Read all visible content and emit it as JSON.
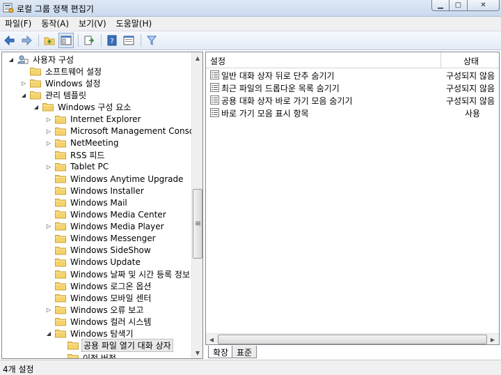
{
  "window": {
    "title": "로컬 그룹 정책 편집기",
    "icon": "gpedit-icon",
    "buttons": {
      "minimize": "▁",
      "maximize": "▢",
      "close": "✕"
    }
  },
  "menu": [
    "파일(F)",
    "동작(A)",
    "보기(V)",
    "도움말(H)"
  ],
  "toolbar": {
    "buttons": [
      "back-icon",
      "forward-icon",
      "up-folder-icon",
      "show-hide-tree-icon",
      "export-list-icon",
      "help-icon",
      "properties-icon",
      "filter-icon"
    ]
  },
  "tree": {
    "rows": [
      {
        "label": "사용자 구성",
        "expander": "expanded",
        "icon": "user-config-icon"
      },
      {
        "label": "소프트웨어 설정",
        "expander": "none",
        "icon": "folder-icon"
      },
      {
        "label": "Windows 설정",
        "expander": "collapsed",
        "icon": "folder-icon"
      },
      {
        "label": "관리 템플릿",
        "expander": "expanded",
        "icon": "folder-icon"
      },
      {
        "label": "Windows 구성 요소",
        "expander": "expanded",
        "icon": "folder-icon"
      },
      {
        "label": "Internet Explorer",
        "expander": "collapsed",
        "icon": "folder-icon"
      },
      {
        "label": "Microsoft Management Console",
        "expander": "collapsed",
        "icon": "folder-icon"
      },
      {
        "label": "NetMeeting",
        "expander": "collapsed",
        "icon": "folder-icon"
      },
      {
        "label": "RSS 피드",
        "expander": "none",
        "icon": "folder-icon"
      },
      {
        "label": "Tablet PC",
        "expander": "collapsed",
        "icon": "folder-icon"
      },
      {
        "label": "Windows Anytime Upgrade",
        "expander": "none",
        "icon": "folder-icon"
      },
      {
        "label": "Windows Installer",
        "expander": "none",
        "icon": "folder-icon"
      },
      {
        "label": "Windows Mail",
        "expander": "none",
        "icon": "folder-icon"
      },
      {
        "label": "Windows Media Center",
        "expander": "none",
        "icon": "folder-icon"
      },
      {
        "label": "Windows Media Player",
        "expander": "collapsed",
        "icon": "folder-icon"
      },
      {
        "label": "Windows Messenger",
        "expander": "none",
        "icon": "folder-icon"
      },
      {
        "label": "Windows SideShow",
        "expander": "none",
        "icon": "folder-icon"
      },
      {
        "label": "Windows Update",
        "expander": "none",
        "icon": "folder-icon"
      },
      {
        "label": "Windows 날짜 및 시간 등록 정보",
        "expander": "none",
        "icon": "folder-icon"
      },
      {
        "label": "Windows 로그온 옵션",
        "expander": "none",
        "icon": "folder-icon"
      },
      {
        "label": "Windows 모바일 센터",
        "expander": "none",
        "icon": "folder-icon"
      },
      {
        "label": "Windows 오류 보고",
        "expander": "collapsed",
        "icon": "folder-icon"
      },
      {
        "label": "Windows 컬러 시스템",
        "expander": "none",
        "icon": "folder-icon"
      },
      {
        "label": "Windows 탐색기",
        "expander": "expanded",
        "icon": "folder-icon"
      },
      {
        "label": "공용 파일 열기 대화 상자",
        "expander": "none",
        "icon": "folder-icon",
        "selected": true
      },
      {
        "label": "이전 버전",
        "expander": "none",
        "icon": "folder-icon"
      }
    ]
  },
  "list": {
    "columns": [
      "설정",
      "상태"
    ],
    "rows": [
      {
        "name": "일반 대화 상자 뒤로 단추 숨기기",
        "state": "구성되지 않음"
      },
      {
        "name": "최근 파일의 드롭다운 목록 숨기기",
        "state": "구성되지 않음"
      },
      {
        "name": "공용 대화 상자 바로 가기 모음 숨기기",
        "state": "구성되지 않음"
      },
      {
        "name": "바로 가기 모음 표시 항목",
        "state": "사용"
      }
    ]
  },
  "tabs": [
    "확장",
    "표준"
  ],
  "status": {
    "text": "4개 설정"
  },
  "colors": {
    "folder": "#f5d36b",
    "folder_edge": "#c9a03a",
    "accent": "#3a78c8"
  }
}
